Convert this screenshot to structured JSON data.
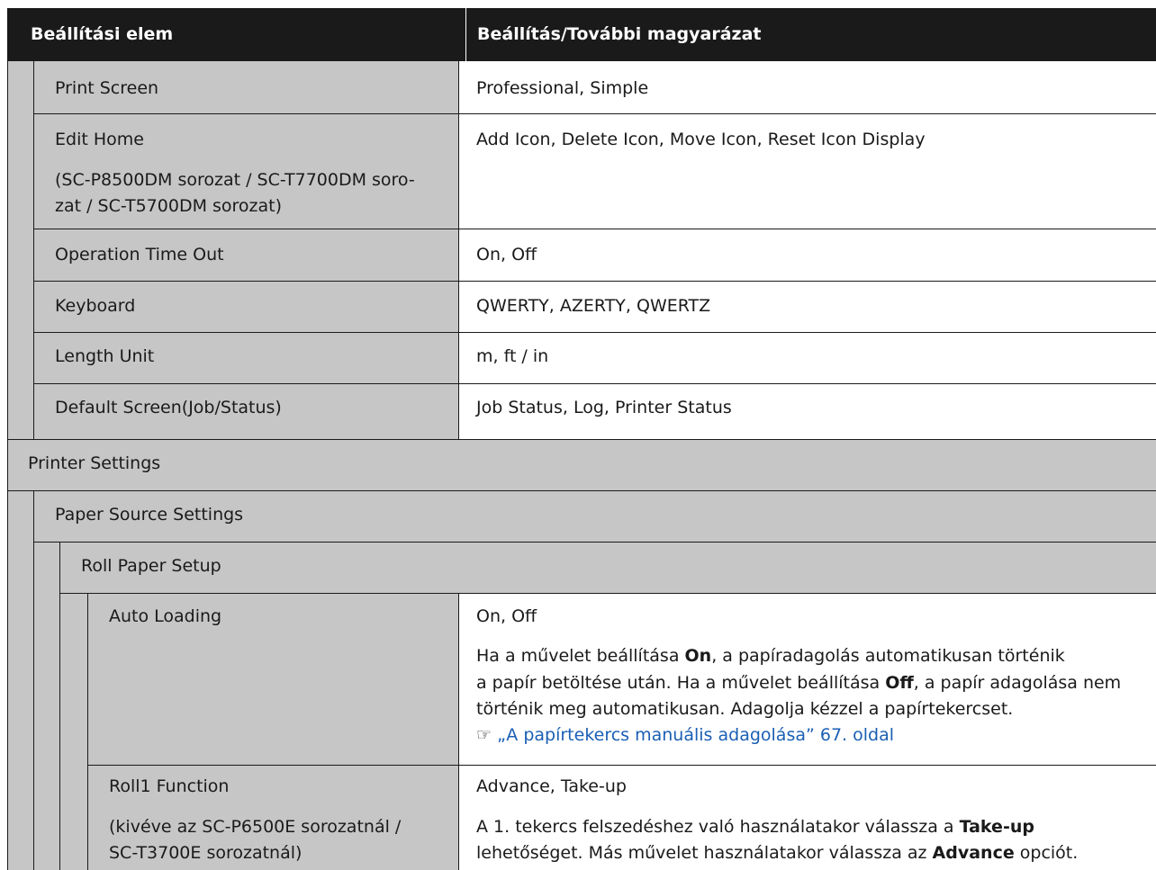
{
  "header": {
    "col1": "Beállítási elem",
    "col2": "Beállítás/További magyarázat"
  },
  "rows": {
    "print_screen": {
      "label": "Print Screen",
      "value": "Professional, Simple"
    },
    "edit_home": {
      "label": "Edit Home",
      "note1": "(SC-P8500DM sorozat / SC-T7700DM soro-",
      "note2": "zat / SC-T5700DM sorozat)",
      "value": "Add Icon, Delete Icon, Move Icon, Reset Icon Display"
    },
    "op_timeout": {
      "label": "Operation Time Out",
      "value": "On, Off"
    },
    "keyboard": {
      "label": "Keyboard",
      "value": "QWERTY, AZERTY, QWERTZ"
    },
    "length_unit": {
      "label": "Length Unit",
      "value": "m, ft / in"
    },
    "default_screen": {
      "label": "Default Screen(Job/Status)",
      "value": "Job Status, Log, Printer Status"
    },
    "printer_settings": {
      "label": "Printer Settings"
    },
    "paper_source_settings": {
      "label": "Paper Source Settings"
    },
    "roll_paper_setup": {
      "label": "Roll Paper Setup"
    },
    "auto_loading": {
      "label": "Auto Loading",
      "value": "On, Off",
      "d1a": "Ha a művelet beállítása ",
      "d1b": "On",
      "d1c": ", a papíradagolás automatikusan történik",
      "d2a": "a papír betöltése után. Ha a művelet beállítása ",
      "d2b": "Off",
      "d2c": ", a papír adagolása nem",
      "d3": "történik meg automatikusan. Adagolja kézzel a papírtekercset.",
      "link_icon": "☞",
      "link": "„A papírtekercs manuális adagolása” 67. oldal"
    },
    "roll1_function": {
      "label": "Roll1 Function",
      "note1": "(kivéve az SC-P6500E sorozatnál /",
      "note2": "SC-T3700E sorozatnál)",
      "value": "Advance, Take-up",
      "d1a": "A 1. tekercs felszedéshez való használatakor válassza a ",
      "d1b": "Take-up",
      "d2a": "lehetőséget. Más művelet használatakor válassza az ",
      "d2b": "Advance",
      "d2c": " opciót."
    }
  }
}
